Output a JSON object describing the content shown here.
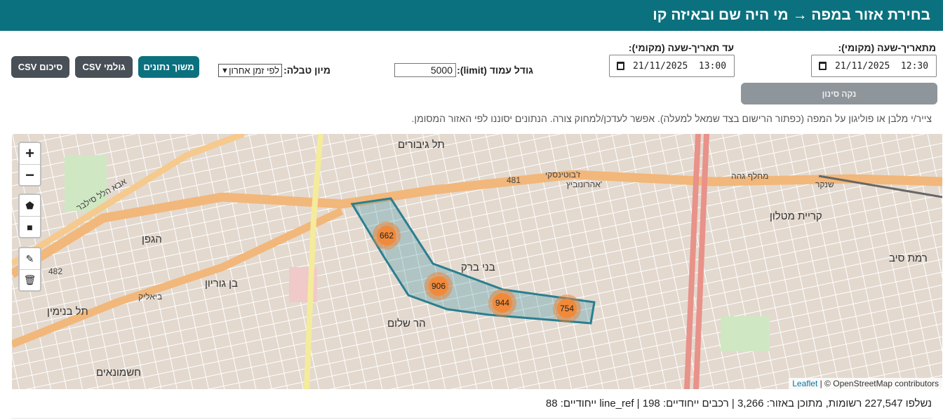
{
  "header": {
    "title": "בחירת אזור במפה → מי היה שם ובאיזה קו"
  },
  "filters": {
    "from_label": "מתאריך-שעה (מקומי):",
    "from_value": "21/11/2025  12:30",
    "to_label": "עד תאריך-שעה (מקומי):",
    "to_value": "21/11/2025  13:00",
    "clear_label": "נקה סינון",
    "limit_label": "גודל עמוד (limit):",
    "limit_value": "5000",
    "sort_label": "מיון טבלה:",
    "sort_value": "לפי זמן אחרון"
  },
  "buttons": {
    "fetch": "משוך נתונים",
    "csv_raw": "CSV גולמי",
    "csv_summary": "CSV סיכום"
  },
  "instructions": "צייר/י מלבן או פוליגון על המפה (כפתור הרישום בצד שמאל למעלה). אפשר לעדכן/למחוק צורה. הנתונים יסוננו לפי האזור המסומן.",
  "map": {
    "zoom_in": "+",
    "zoom_out": "−",
    "tools": [
      "polygon-icon",
      "rectangle-icon",
      "edit-icon",
      "trash-icon"
    ],
    "clusters": [
      "662",
      "906",
      "944",
      "754"
    ],
    "labels": {
      "tel_giborim": "תל גיבורים",
      "bnei_brak": "בני ברק",
      "ben_gurion": "בן גוריון",
      "bialik": "ביאליק",
      "har_shalom": "הר שלום",
      "kiryat_matalon": "קריית מטלון",
      "ramat_siv": "רמת סיב",
      "hashmonaim": "חשמונאים",
      "tel_binyamin": "תל בנימין",
      "hagefen": "הגפן",
      "jabotinsky": "ז'בוטינסקי",
      "aharonovich": "אהרונוביץ'",
      "gehe": "מחלף גהה",
      "shenkar": "שנקר",
      "r481": "481",
      "r482": "482",
      "abba_hillel": "אבא הלל סילבר"
    },
    "attribution_leaflet": "Leaflet",
    "attribution_osm": "| © OpenStreetMap contributors",
    "colors": {
      "polygon": "#2a7f8f",
      "cluster": "#f07f2f",
      "road": "#f6c98c",
      "highway": "#e8928a"
    }
  },
  "stats": "נשלפו 227,547 רשומות, מתוכן באזור: 3,266 | רכבים ייחודיים: 198 | line_ref ייחודיים: 88",
  "colors": {
    "header": "#0b717f",
    "dark_button": "#495057"
  }
}
